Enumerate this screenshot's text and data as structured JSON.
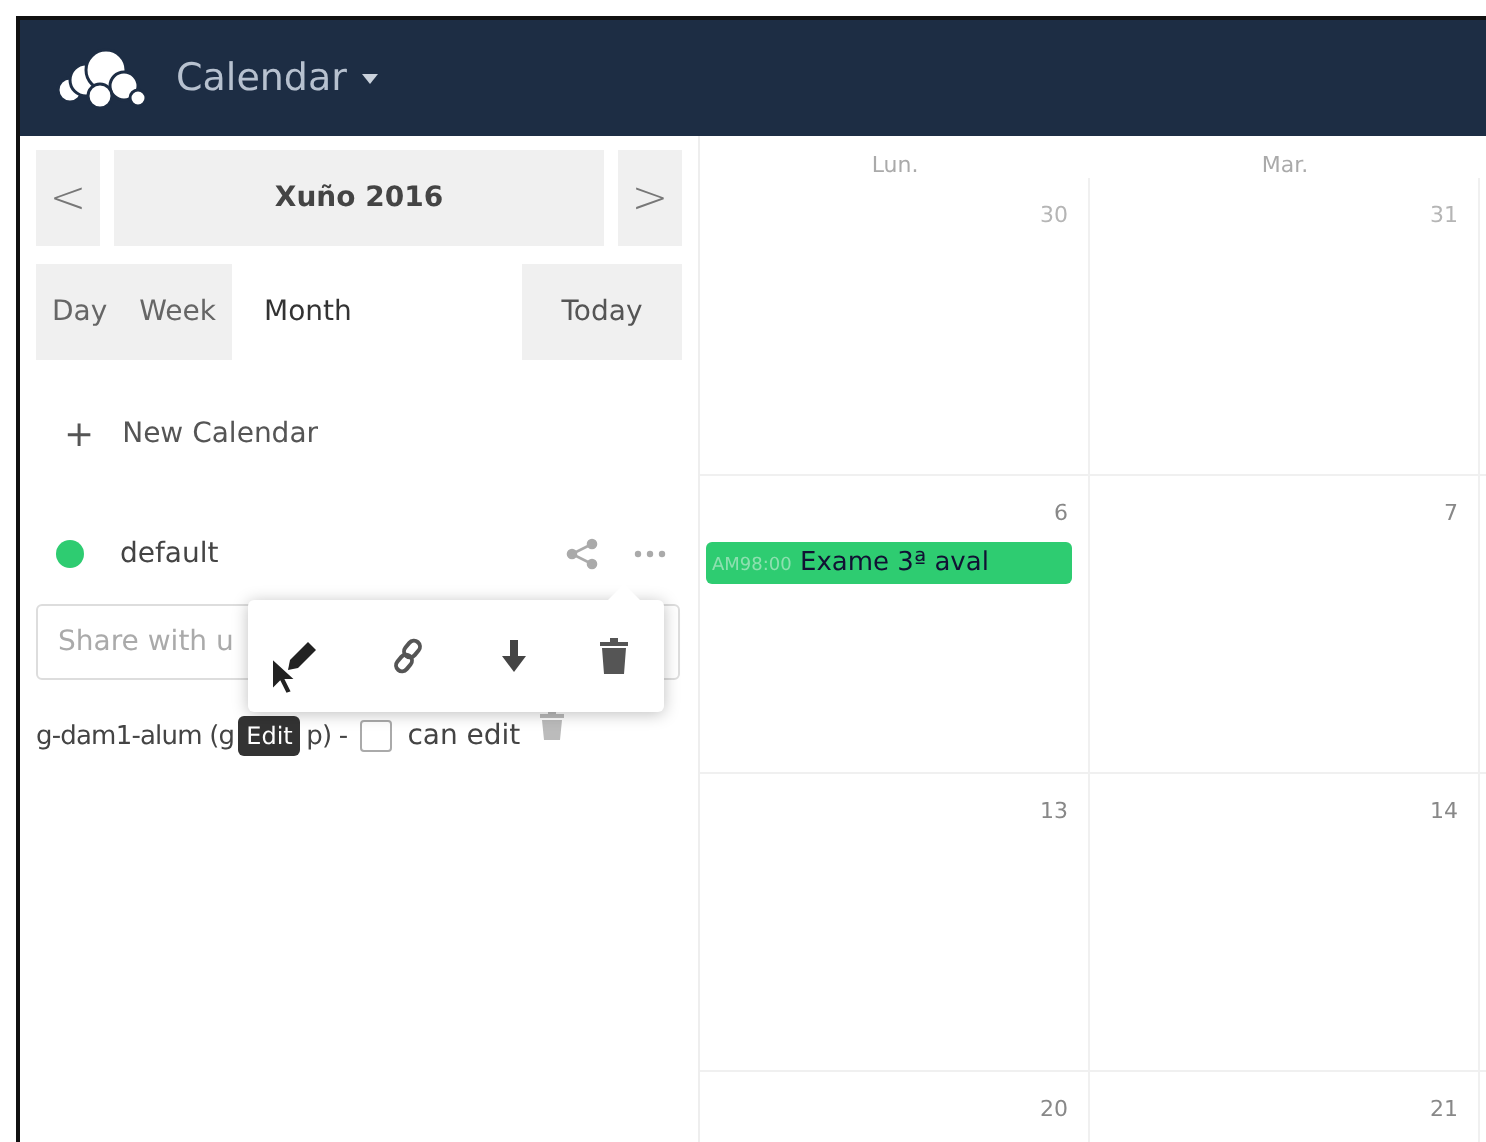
{
  "header": {
    "app_title": "Calendar"
  },
  "sidebar": {
    "month_nav": {
      "prev": "<",
      "label": "Xuño 2016",
      "next": ">"
    },
    "views": [
      {
        "label": "Day",
        "selected": false
      },
      {
        "label": "Week",
        "selected": false
      },
      {
        "label": "Month",
        "selected": true
      }
    ],
    "today_button": "Today",
    "new_calendar": {
      "icon": "+",
      "label": "New Calendar"
    },
    "calendars": [
      {
        "name": "default",
        "color": "#2ecc71"
      }
    ],
    "share_field": {
      "placeholder": "Share with u"
    },
    "share_entry": {
      "name_before": "g-dam1-alum (g",
      "name_after": "p) -",
      "can_edit": {
        "label": "can edit",
        "checked": false
      }
    },
    "tooltip": "Edit"
  },
  "calendar": {
    "weekdays": [
      "Lun.",
      "Mar."
    ],
    "weeks": [
      [
        {
          "day": "30",
          "other_month": true
        },
        {
          "day": "31",
          "other_month": true
        }
      ],
      [
        {
          "day": "6",
          "other_month": false,
          "events": [
            {
              "time": "AM98:00",
              "title": "Exame 3ª aval",
              "color": "#2ecc71"
            }
          ]
        },
        {
          "day": "7",
          "other_month": false
        }
      ],
      [
        {
          "day": "13",
          "other_month": false
        },
        {
          "day": "14",
          "other_month": false
        }
      ],
      [
        {
          "day": "20",
          "other_month": false
        },
        {
          "day": "21",
          "other_month": false
        }
      ]
    ]
  }
}
